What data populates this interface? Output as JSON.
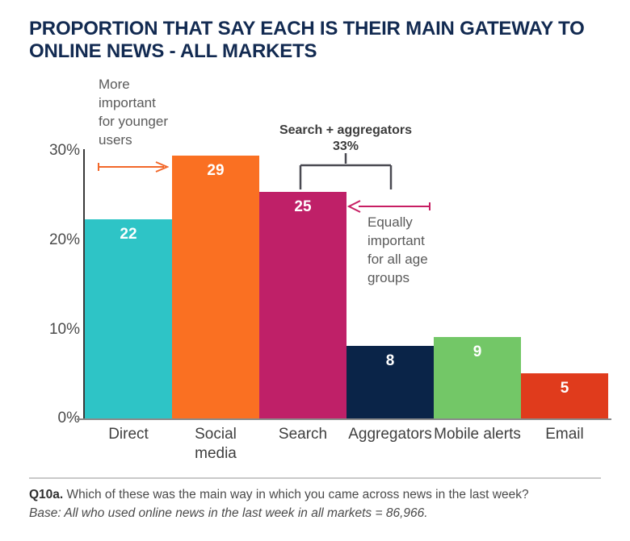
{
  "title": "PROPORTION THAT SAY EACH IS THEIR MAIN GATEWAY TO ONLINE NEWS - ALL MARKETS",
  "chart_data": {
    "type": "bar",
    "title": "PROPORTION THAT SAY EACH IS THEIR MAIN GATEWAY TO ONLINE NEWS - ALL MARKETS",
    "xlabel": "",
    "ylabel": "",
    "ylim": [
      0,
      30
    ],
    "grid": false,
    "legend": "none",
    "categories": [
      "Direct",
      "Social media",
      "Search",
      "Aggregators",
      "Mobile alerts",
      "Email"
    ],
    "values": [
      22,
      29,
      25,
      8,
      9,
      5
    ],
    "value_labels": [
      "22",
      "29",
      "25",
      "8",
      "9",
      "5"
    ],
    "colors": [
      "#2EC4C6",
      "#FA7022",
      "#BF2068",
      "#0A2448",
      "#73C767",
      "#E03B1C"
    ],
    "ytick_labels": [
      "30%",
      "20%",
      "10%",
      "0%"
    ],
    "ytick_values": [
      30,
      20,
      10,
      0
    ],
    "annotations": [
      {
        "name": "more-important-younger",
        "text": "More important for younger users",
        "color": "#F2682A",
        "direction": "right"
      },
      {
        "name": "search-plus-aggregators",
        "text": "Search + aggregators",
        "value": "33%",
        "color": "#3c3c3c"
      },
      {
        "name": "equally-important",
        "text": "Equally important for all age groups",
        "color": "#C71E63",
        "direction": "left"
      }
    ]
  },
  "annotations": {
    "younger": {
      "line1": "More",
      "line2": "important",
      "line3": "for younger",
      "line4": "users"
    },
    "bracket": {
      "label": "Search + aggregators",
      "value": "33%"
    },
    "equally": {
      "line1": "Equally",
      "line2": "important",
      "line3": "for all age",
      "line4": "groups"
    }
  },
  "footer": {
    "question_code": "Q10a.",
    "question": " Which of these was the main way in which you came across news in the last week?",
    "base": "Base: All who used online news in the last week in all markets = 86,966."
  },
  "colors": {
    "title": "#122a51",
    "orange_accent": "#F2682A",
    "pink_accent": "#C71E63",
    "axis": "#8a8a8a"
  }
}
